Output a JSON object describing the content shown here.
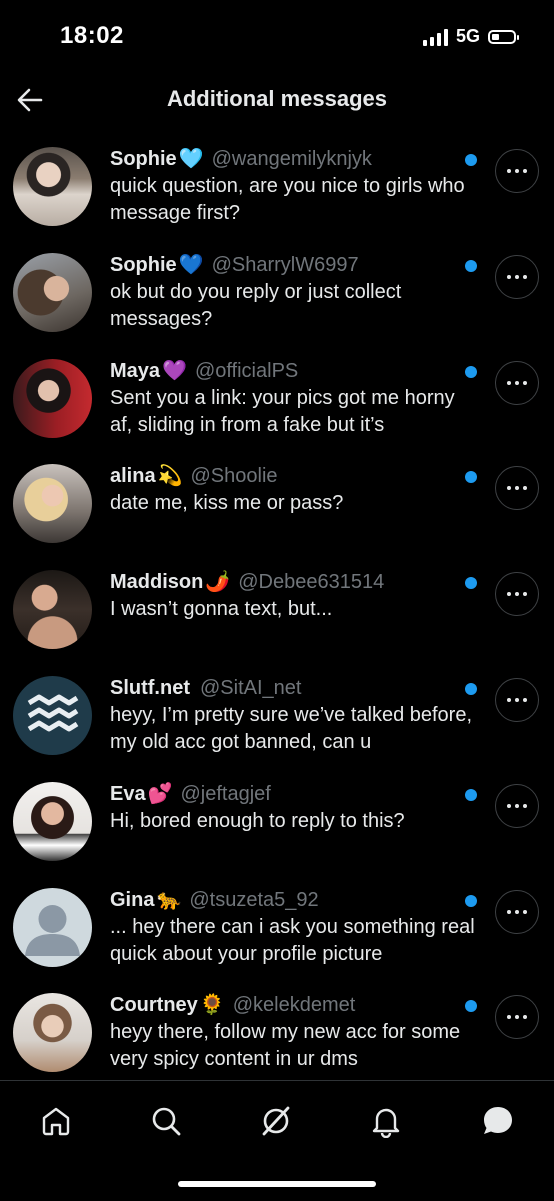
{
  "status_bar": {
    "time": "18:02",
    "network": "5G"
  },
  "header": {
    "title": "Additional messages",
    "back_icon": "arrow-left-icon"
  },
  "colors": {
    "background": "#000000",
    "text": "#e7e9ea",
    "handle": "#71767b",
    "unread_dot": "#1d9bf0",
    "divider": "#2f3336"
  },
  "conversations": [
    {
      "name": "Sophie",
      "emoji": "🩵",
      "handle": "@wangemilyknjyk",
      "preview": "quick question, are you nice to girls who message first?",
      "unread": true
    },
    {
      "name": "Sophie",
      "emoji": "💙",
      "handle": "@SharrylW6997",
      "preview": "ok but do you reply or just collect messages?",
      "unread": true
    },
    {
      "name": "Maya",
      "emoji": "💜",
      "handle": "@officialPS",
      "preview": "Sent you a link: your pics got me horny af, sliding in from a fake but it’s",
      "unread": true
    },
    {
      "name": "alina",
      "emoji": "💫",
      "handle": "@Shoolie",
      "preview": "date me, kiss me or pass?",
      "unread": true
    },
    {
      "name": "Maddison",
      "emoji": "🌶️",
      "handle": "@Debee631514",
      "preview": "I wasn’t gonna text, but...",
      "unread": true
    },
    {
      "name": "Slutf.net",
      "emoji": "",
      "handle": "@SitAI_net",
      "preview": "heyy, I’m pretty sure we’ve talked before, my old acc got banned, can u",
      "unread": true
    },
    {
      "name": "Eva",
      "emoji": "💕",
      "handle": "@jeftagjef",
      "preview": "Hi, bored enough to reply to this?",
      "unread": true
    },
    {
      "name": "Gina",
      "emoji": "🐆",
      "handle": "@tsuzeta5_92",
      "preview": "... hey there can i ask you something real quick about your profile picture",
      "unread": true
    },
    {
      "name": "Courtney",
      "emoji": "🌻",
      "handle": "@kelekdemet",
      "preview": "heyy there, follow my new acc for some very spicy content in ur dms",
      "unread": true
    }
  ],
  "tab_bar": {
    "items": [
      "home-icon",
      "search-icon",
      "grok-icon",
      "notifications-icon",
      "messages-icon"
    ],
    "active": "messages-icon"
  }
}
